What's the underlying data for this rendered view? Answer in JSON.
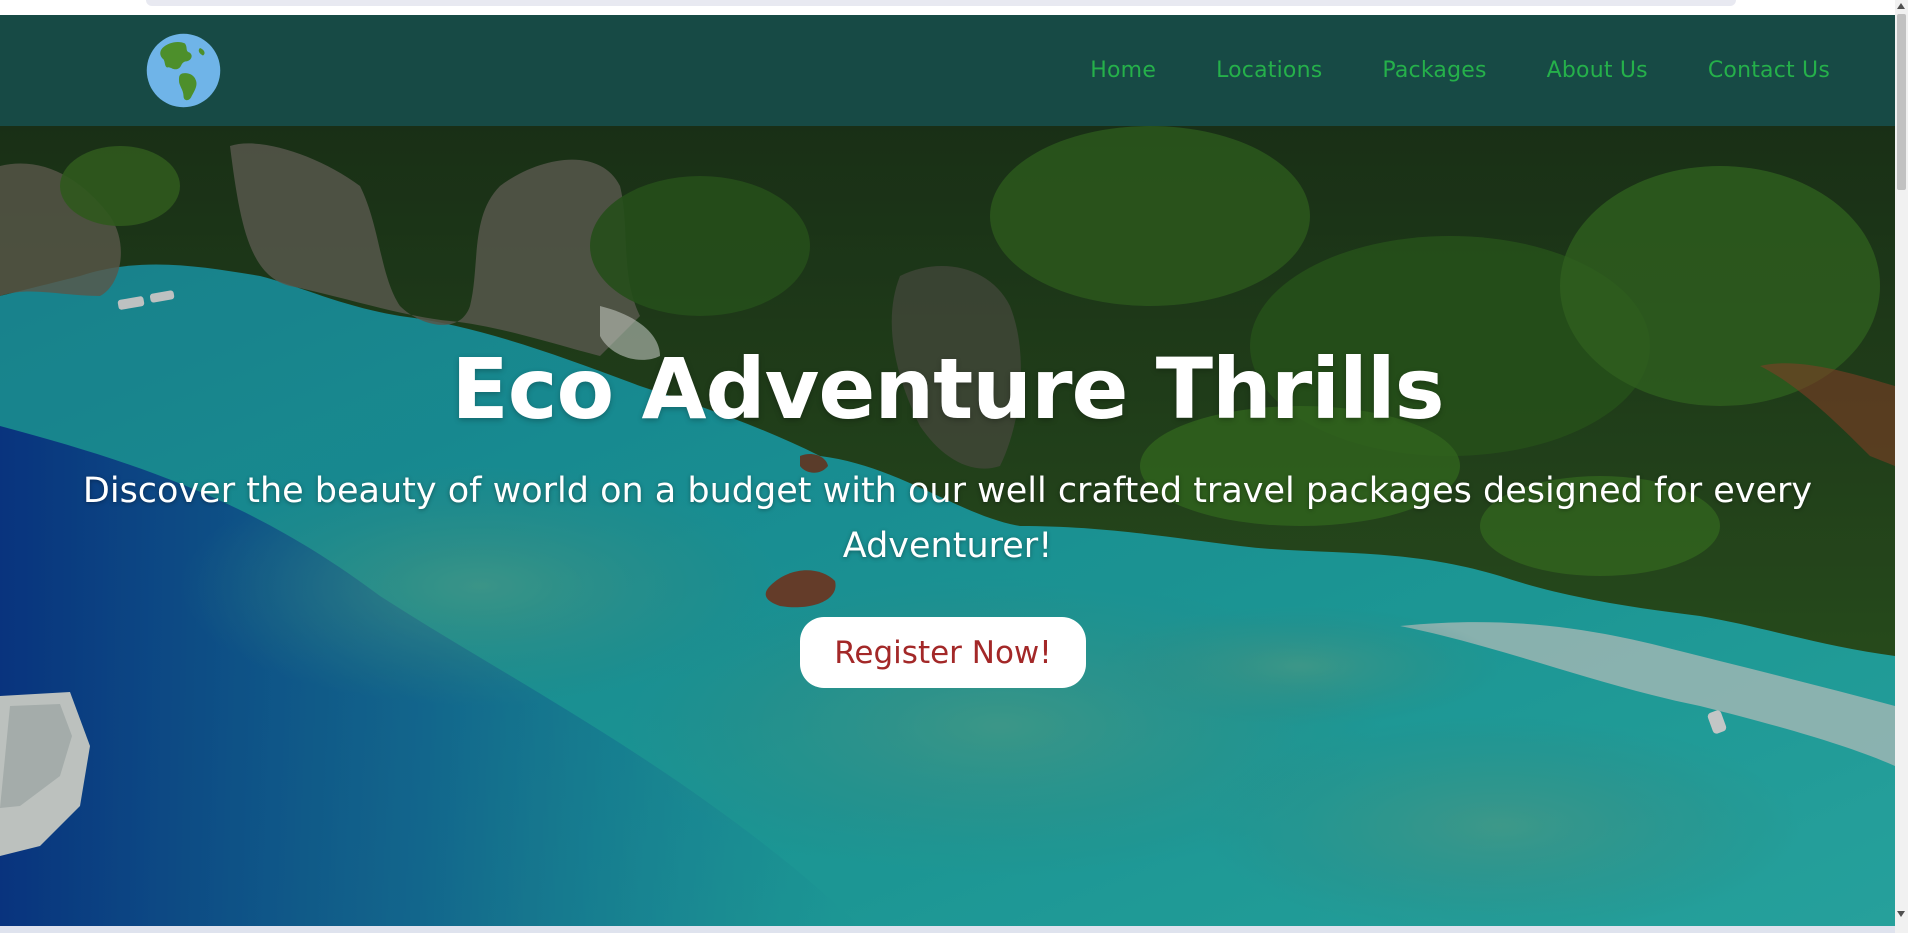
{
  "nav": {
    "logo_icon": "globe-americas-icon",
    "links": [
      "Home",
      "Locations",
      "Packages",
      "About Us",
      "Contact Us"
    ]
  },
  "hero": {
    "title": "Eco Adventure Thrills",
    "subtitle": "Discover the beauty of world on a budget with our well crafted travel packages designed for every Adventurer!",
    "cta_label": "Register Now!"
  },
  "colors": {
    "navbar_bg": "#174a45",
    "nav_link": "#25b04a",
    "cta_text": "#a32828",
    "hero_text": "#ffffff"
  }
}
